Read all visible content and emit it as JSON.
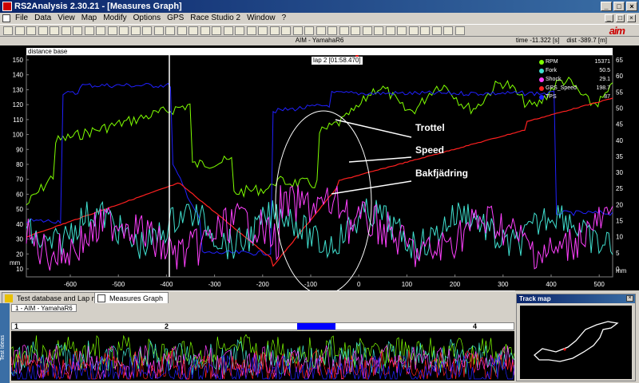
{
  "window": {
    "title": "RS2Analysis 2.30.21 - [Measures Graph]",
    "controls": [
      "_",
      "□",
      "×"
    ]
  },
  "menu": [
    "File",
    "Data",
    "View",
    "Map",
    "Modify",
    "Options",
    "GPS",
    "Race Studio 2",
    "Window",
    "?"
  ],
  "brand": {
    "logo_text": "aim"
  },
  "graph": {
    "header_title": "AIM - YamahaR6",
    "time_text": "time -11.322 [s]",
    "dist_text": "dist -389.7 [m]",
    "distance_base": "distance base",
    "lap_label": "lap 2 [01:58.470]",
    "y_left_ticks": [
      "150",
      "140",
      "130",
      "120",
      "110",
      "100",
      "90",
      "80",
      "70",
      "60",
      "50",
      "40",
      "30",
      "20",
      "10"
    ],
    "y_left_unit": "mm",
    "y_right_ticks": [
      "65",
      "60",
      "55",
      "50",
      "45",
      "40",
      "35",
      "30",
      "25",
      "20",
      "15",
      "10",
      "5",
      "0"
    ],
    "y_right_unit": "mm",
    "x_ticks": [
      "-600",
      "-500",
      "-400",
      "-300",
      "-200",
      "-100",
      "0",
      "100",
      "200",
      "300",
      "400",
      "500"
    ],
    "legend": [
      {
        "name": "RPM",
        "value": "15371",
        "color": "#7fff00"
      },
      {
        "name": "Fork",
        "value": "50.5",
        "color": "#40e0d0"
      },
      {
        "name": "Shock",
        "value": "29.1",
        "color": "#ff40ff"
      },
      {
        "name": "GPS_Speed",
        "value": "198.7",
        "color": "#ff2020"
      },
      {
        "name": "TPS",
        "value": "87",
        "color": "#2020ff"
      }
    ],
    "annotations": {
      "throttle": "Trottel",
      "speed": "Speed",
      "rear_suspension": "Bakfjädring"
    }
  },
  "tabs": [
    {
      "label": "Test database and Lap manager"
    },
    {
      "label": "Measures Graph"
    }
  ],
  "overview": {
    "title": "1 - AIM - YamahaR6",
    "side_label": "Test Ideas",
    "lap_numbers": [
      "1",
      "2",
      "4"
    ]
  },
  "track_map": {
    "title": "Track map"
  }
}
